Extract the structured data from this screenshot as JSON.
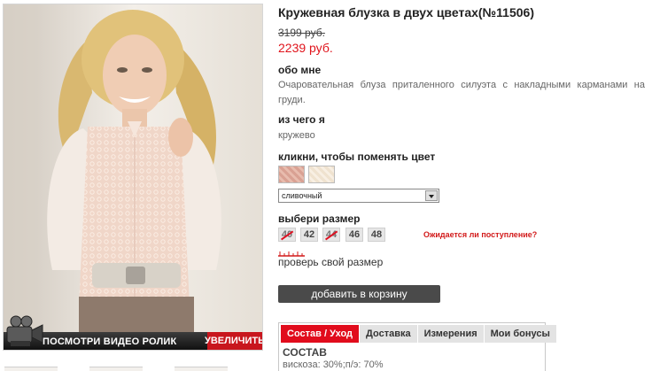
{
  "product": {
    "title": "Кружевная блузка в двух цветах(№11506)",
    "old_price": "3199 руб.",
    "new_price": "2239 руб."
  },
  "about": {
    "heading": "обо мне",
    "text": "Очаровательная блуза приталенного силуэта с накладными карманами на груди."
  },
  "material": {
    "heading": "из чего я",
    "text": "кружево"
  },
  "color": {
    "heading": "кликни, чтобы поменять цвет",
    "swatches": [
      "pink-lace-swatch",
      "cream-lace-swatch"
    ],
    "selected": "сливочный"
  },
  "size": {
    "heading": "выбери размер",
    "options": [
      {
        "label": "40",
        "available": false
      },
      {
        "label": "42",
        "available": true
      },
      {
        "label": "44",
        "available": false
      },
      {
        "label": "46",
        "available": true
      },
      {
        "label": "48",
        "available": true
      }
    ],
    "awaiting_link": "Ожидается ли поступление?",
    "check_size": "проверь свой размер"
  },
  "cart": {
    "button": "добавить в корзину"
  },
  "photo": {
    "video_label": "ПОСМОТРИ ВИДЕО РОЛИК",
    "zoom_label": "УВЕЛИЧИТЬ"
  },
  "tabs": {
    "items": [
      "Состав / Уход",
      "Доставка",
      "Измерения",
      "Мои бонусы"
    ],
    "active_index": 0,
    "content_heading": "СОСТАВ",
    "content_text": "вискоза: 30%;п/э: 70%"
  },
  "colors": {
    "accent_red": "#e10c1c",
    "price_red": "#e0141c",
    "button_dark": "#4a4a4a"
  }
}
